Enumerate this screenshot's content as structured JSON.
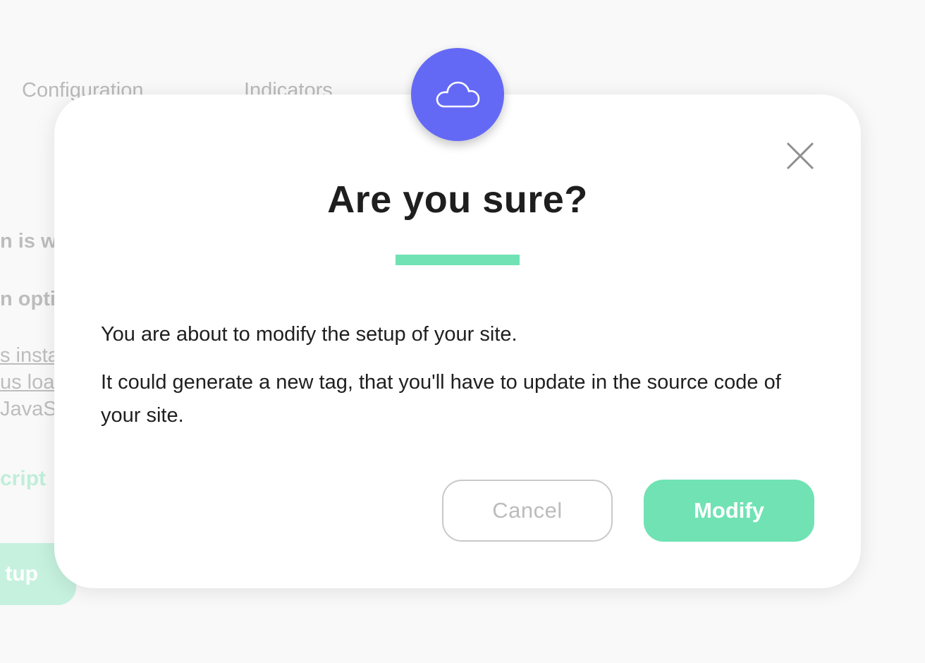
{
  "background": {
    "tabs": {
      "configuration": "Configuration",
      "indicators": "Indicators"
    },
    "text_fragments": [
      "n is we",
      "n optic",
      "s insta",
      "us loa",
      "JavaS"
    ],
    "green_text": "cript",
    "button_label": "tup"
  },
  "modal": {
    "icon": "cloud-icon",
    "close_icon": "close-icon",
    "title": "Are you sure?",
    "message_line1": "You are about to modify the setup of your site.",
    "message_line2": "It could generate a new tag, that you'll have to update in the source code of your site.",
    "cancel_label": "Cancel",
    "confirm_label": "Modify"
  },
  "colors": {
    "accent_green": "#70e2b4",
    "badge_purple": "#6469f5",
    "title_text": "#1e1e1e"
  }
}
